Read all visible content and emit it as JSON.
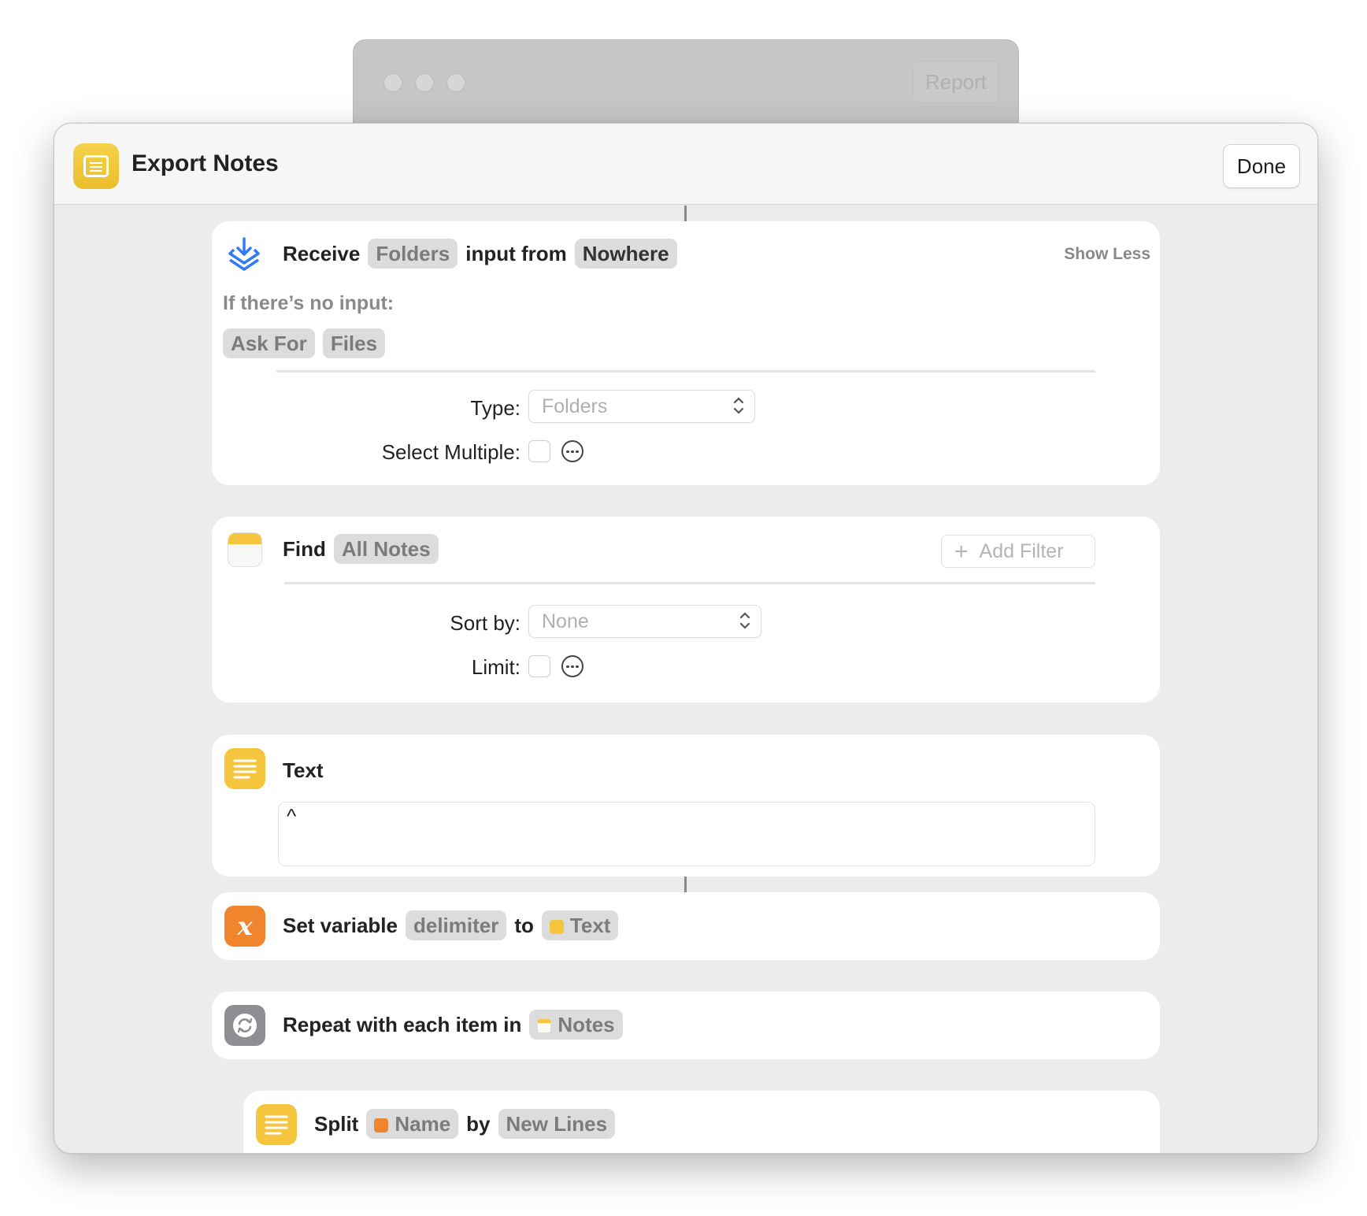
{
  "background_window": {
    "report_label": "Report"
  },
  "header": {
    "title": "Export Notes",
    "done_label": "Done"
  },
  "receive_card": {
    "verb": "Receive",
    "type_token": "Folders",
    "middle": "input from",
    "source_token": "Nowhere",
    "show_less": "Show Less",
    "no_input_label": "If there’s no input:",
    "ask_for_token": "Ask For",
    "files_token": "Files",
    "type_label": "Type:",
    "type_value": "Folders",
    "select_multiple_label": "Select Multiple:"
  },
  "find_card": {
    "verb": "Find",
    "notes_token": "All Notes",
    "add_filter": "Add Filter",
    "sort_label": "Sort by:",
    "sort_value": "None",
    "limit_label": "Limit:"
  },
  "text_card": {
    "title": "Text",
    "content": "^"
  },
  "set_variable_card": {
    "verb": "Set variable",
    "var_token": "delimiter",
    "to": "to",
    "value_token": "Text"
  },
  "repeat_card": {
    "label": "Repeat with each item in",
    "token": "Notes"
  },
  "split_card": {
    "verb": "Split",
    "name_token": "Name",
    "by": "by",
    "mode_token": "New Lines"
  },
  "colors": {
    "accent_yellow": "#f4c63d",
    "variable_orange": "#f0852d",
    "repeat_gray": "#8e8e93",
    "receive_blue": "#2f7cf6"
  }
}
